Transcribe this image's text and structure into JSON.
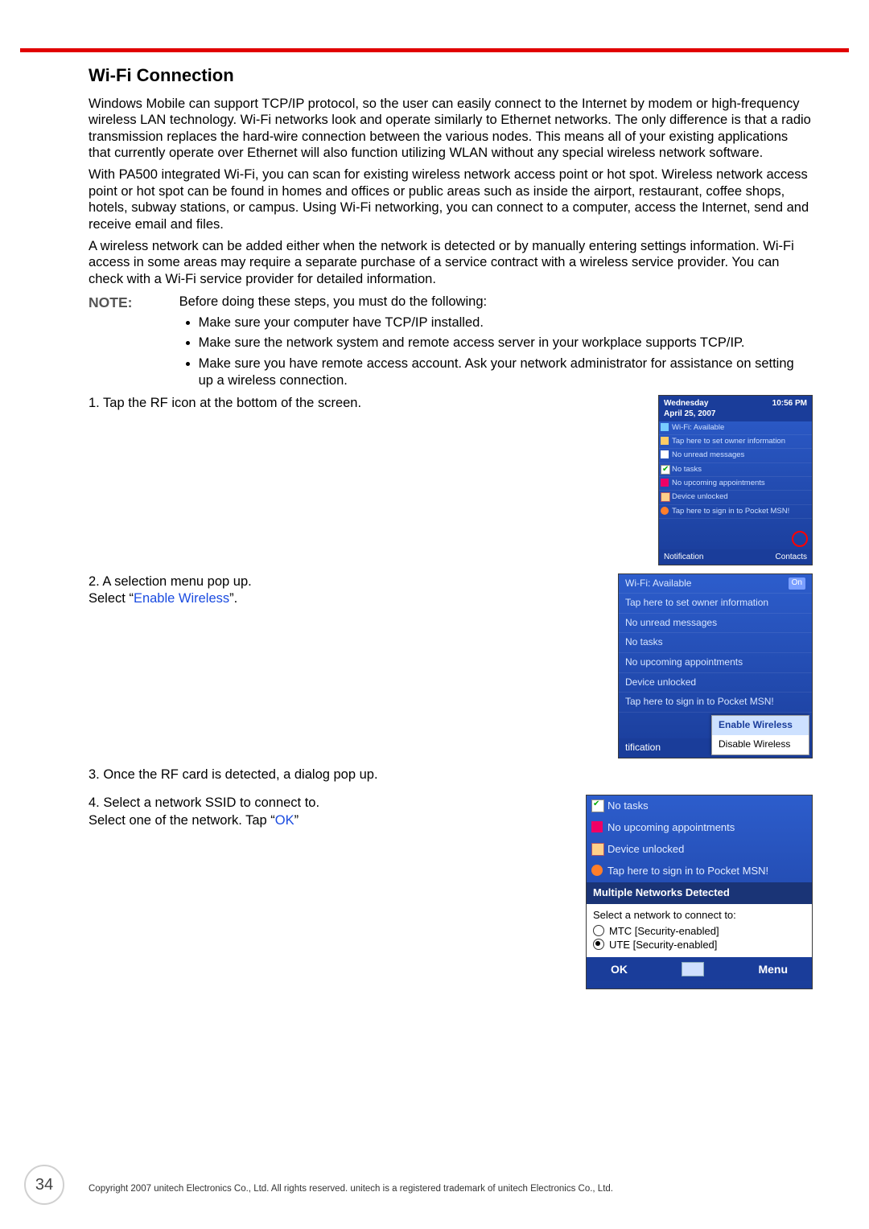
{
  "heading": "Wi-Fi Connection",
  "para1": "Windows Mobile can support TCP/IP protocol, so the user can easily connect to the Internet by modem or high-frequency wireless LAN technology. Wi-Fi networks look and operate similarly to Ethernet networks. The only difference is that a radio transmission replaces the hard-wire connection between the various nodes. This means all of your existing applications that currently operate over Ethernet will also function utilizing WLAN without any special wireless network software.",
  "para2": "With PA500 integrated Wi-Fi, you can scan for existing wireless network access point or hot spot. Wireless network access point or hot spot can be found in homes and offices or public areas such as inside the airport, restaurant, coffee shops, hotels, subway stations, or campus. Using Wi-Fi networking, you can connect to a computer, access the Internet, send and receive email and files.",
  "para3": "A wireless network can be added either when the network is detected or by manually entering settings information. Wi-Fi access in some areas may require a separate purchase of a service contract with a wireless service provider. You can check with a Wi-Fi service provider for detailed information.",
  "note_label": "NOTE:",
  "note_intro": "Before doing these steps, you must do the following:",
  "note_bullets": [
    "Make sure your computer have TCP/IP installed.",
    "Make sure the network system and remote access server in your workplace supports TCP/IP.",
    "Make sure you have remote access account. Ask your network administrator for assistance on setting up a wireless connection."
  ],
  "step1": "1. Tap the RF icon at the bottom of the screen.",
  "step2a": "2. A selection menu pop up.",
  "step2b_pre": "Select “",
  "step2b_link": "Enable Wireless",
  "step2b_post": "”.",
  "step3": "3. Once the RF card is detected, a dialog pop up.",
  "step4a": "4. Select a network SSID to connect to.",
  "step4b_pre": "Select one of the network. Tap “",
  "step4b_link": "OK",
  "step4b_post": "”",
  "dev1": {
    "hdr_day": "Wednesday",
    "hdr_date": "April 25, 2007",
    "hdr_time": "10:56 PM",
    "rows": [
      "Wi-Fi: Available",
      "Tap here to set owner information",
      "No unread messages",
      "No tasks",
      "No upcoming appointments",
      "Device unlocked",
      "Tap here to sign in to Pocket MSN!"
    ],
    "foot_left": "Notification",
    "foot_right": "Contacts"
  },
  "dev2": {
    "wifi_label": "Wi-Fi: Available",
    "wifi_badge": "On",
    "rows": [
      "Tap here to set owner information",
      "No unread messages",
      "No tasks",
      "No upcoming appointments",
      "Device unlocked",
      "Tap here to sign in to Pocket MSN!"
    ],
    "menu_enable": "Enable Wireless",
    "menu_disable": "Disable Wireless",
    "foot": "tification"
  },
  "dev3": {
    "rows": [
      "No tasks",
      "No upcoming appointments",
      "Device unlocked",
      "Tap here to sign in to Pocket MSN!"
    ],
    "dialog_title": "Multiple Networks Detected",
    "dialog_prompt": "Select a network to connect to:",
    "opt1": "MTC [Security-enabled]",
    "opt2": "UTE [Security-enabled]",
    "ok": "OK",
    "menu": "Menu"
  },
  "page_number": "34",
  "copyright": "Copyright 2007 unitech Electronics Co., Ltd. All rights reserved. unitech is a registered trademark of unitech Electronics Co., Ltd."
}
